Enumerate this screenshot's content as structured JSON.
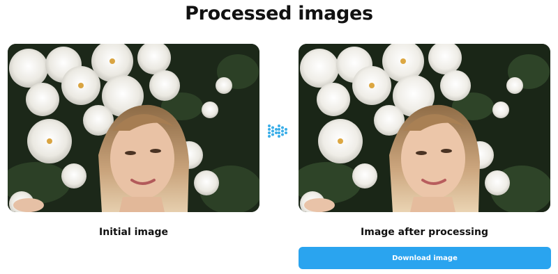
{
  "page": {
    "title": "Processed images"
  },
  "images": {
    "initial": {
      "caption": "Initial image"
    },
    "processed": {
      "caption": "Image after processing"
    }
  },
  "actions": {
    "download_label": "Download image"
  },
  "icons": {
    "separator": "double-chevron-right-icon"
  },
  "colors": {
    "accent": "#2aa4ef",
    "foliage": "#1f2a1c",
    "flowers": "#f1efe9"
  }
}
